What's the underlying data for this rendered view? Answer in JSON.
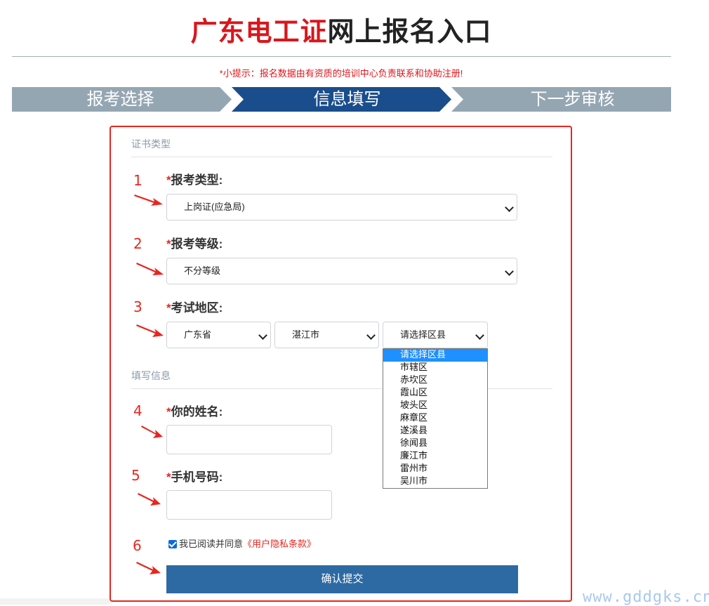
{
  "header": {
    "title_red": "广东电工证",
    "title_dark": "网上报名入口",
    "tip": "*小提示：报名数据由有资质的培训中心负责联系和协助注册!"
  },
  "steps": [
    "报考选择",
    "信息填写",
    "下一步审核"
  ],
  "form": {
    "section1": "证书类型",
    "section2": "填写信息",
    "numbers": [
      "1",
      "2",
      "3",
      "4",
      "5",
      "6"
    ],
    "exam_type": {
      "label": "报考类型:",
      "value": "上岗证(应急局)"
    },
    "exam_level": {
      "label": "报考等级:",
      "value": "不分等级"
    },
    "exam_region": {
      "label": "考试地区:",
      "province": "广东省",
      "city": "湛江市",
      "district": "请选择区县",
      "district_options": [
        "请选择区县",
        "市辖区",
        "赤坎区",
        "霞山区",
        "坡头区",
        "麻章区",
        "遂溪县",
        "徐闻县",
        "廉江市",
        "雷州市",
        "吴川市"
      ]
    },
    "name": {
      "label": "你的姓名:"
    },
    "phone": {
      "label": "手机号码:"
    },
    "agreement": {
      "text": "我已阅读并同意",
      "link": "《用户隐私条款》",
      "checked": true
    },
    "submit": "确认提交"
  },
  "watermark": "www.gddgks.cn",
  "colors": {
    "accent_red": "#e8261f",
    "step_active": "#1a4d8c",
    "step_inactive": "#95a6b3",
    "button": "#2d6aa3"
  }
}
